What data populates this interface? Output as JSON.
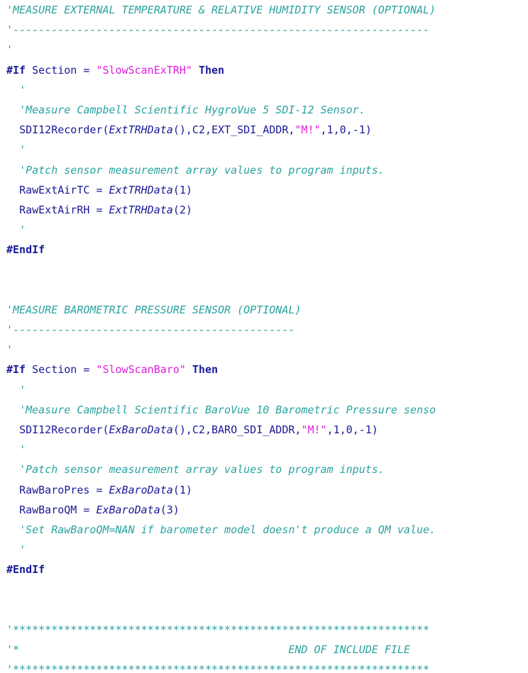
{
  "window": {
    "title": ""
  },
  "code": {
    "lines": [
      {
        "indent": 0,
        "tokens": [
          {
            "t": "cm",
            "v": "'MEASURE EXTERNAL TEMPERATURE & RELATIVE HUMIDITY SENSOR (OPTIONAL)"
          }
        ]
      },
      {
        "indent": 0,
        "tokens": [
          {
            "t": "cm",
            "v": "'-----------------------------------------------------------------"
          }
        ]
      },
      {
        "indent": 0,
        "tokens": [
          {
            "t": "cm",
            "v": "'"
          }
        ]
      },
      {
        "indent": 0,
        "tokens": [
          {
            "t": "kw",
            "v": "#If"
          },
          {
            "t": "plain",
            "v": " Section "
          },
          {
            "t": "op",
            "v": "="
          },
          {
            "t": "plain",
            "v": " "
          },
          {
            "t": "str",
            "v": "\"SlowScanExTRH\""
          },
          {
            "t": "plain",
            "v": " "
          },
          {
            "t": "kw",
            "v": "Then"
          }
        ]
      },
      {
        "indent": 2,
        "tokens": [
          {
            "t": "cm",
            "v": "'"
          }
        ]
      },
      {
        "indent": 2,
        "tokens": [
          {
            "t": "cm",
            "v": "'Measure Campbell Scientific HygroVue 5 SDI-12 Sensor."
          }
        ]
      },
      {
        "indent": 2,
        "tokens": [
          {
            "t": "fn",
            "v": "SDI12Recorder("
          },
          {
            "t": "var",
            "v": "ExtTRHData"
          },
          {
            "t": "plain",
            "v": "(),C2,EXT_SDI_ADDR,"
          },
          {
            "t": "str",
            "v": "\"M!\""
          },
          {
            "t": "plain",
            "v": ",1,0,-1)"
          }
        ]
      },
      {
        "indent": 2,
        "tokens": [
          {
            "t": "cm",
            "v": "'"
          }
        ]
      },
      {
        "indent": 2,
        "tokens": [
          {
            "t": "cm",
            "v": "'Patch sensor measurement array values to program inputs."
          }
        ]
      },
      {
        "indent": 2,
        "tokens": [
          {
            "t": "plain",
            "v": "RawExtAirTC "
          },
          {
            "t": "op",
            "v": "="
          },
          {
            "t": "plain",
            "v": " "
          },
          {
            "t": "var",
            "v": "ExtTRHData"
          },
          {
            "t": "plain",
            "v": "(1)"
          }
        ]
      },
      {
        "indent": 2,
        "tokens": [
          {
            "t": "plain",
            "v": "RawExtAirRH "
          },
          {
            "t": "op",
            "v": "="
          },
          {
            "t": "plain",
            "v": " "
          },
          {
            "t": "var",
            "v": "ExtTRHData"
          },
          {
            "t": "plain",
            "v": "(2)"
          }
        ]
      },
      {
        "indent": 2,
        "tokens": [
          {
            "t": "cm",
            "v": "'"
          }
        ]
      },
      {
        "indent": 0,
        "tokens": [
          {
            "t": "kw",
            "v": "#EndIf"
          }
        ]
      },
      {
        "indent": 0,
        "tokens": []
      },
      {
        "indent": 0,
        "tokens": []
      },
      {
        "indent": 0,
        "tokens": [
          {
            "t": "cm",
            "v": "'MEASURE BAROMETRIC PRESSURE SENSOR (OPTIONAL)"
          }
        ]
      },
      {
        "indent": 0,
        "tokens": [
          {
            "t": "cm",
            "v": "'--------------------------------------------"
          }
        ]
      },
      {
        "indent": 0,
        "tokens": [
          {
            "t": "cm",
            "v": "'"
          }
        ]
      },
      {
        "indent": 0,
        "tokens": [
          {
            "t": "kw",
            "v": "#If"
          },
          {
            "t": "plain",
            "v": " Section "
          },
          {
            "t": "op",
            "v": "="
          },
          {
            "t": "plain",
            "v": " "
          },
          {
            "t": "str",
            "v": "\"SlowScanBaro\""
          },
          {
            "t": "plain",
            "v": " "
          },
          {
            "t": "kw",
            "v": "Then"
          }
        ]
      },
      {
        "indent": 2,
        "tokens": [
          {
            "t": "cm",
            "v": "'"
          }
        ]
      },
      {
        "indent": 2,
        "tokens": [
          {
            "t": "cm",
            "v": "'Measure Campbell Scientific BaroVue 10 Barometric Pressure senso"
          }
        ]
      },
      {
        "indent": 2,
        "tokens": [
          {
            "t": "fn",
            "v": "SDI12Recorder("
          },
          {
            "t": "var",
            "v": "ExBaroData"
          },
          {
            "t": "plain",
            "v": "(),C2,BARO_SDI_ADDR,"
          },
          {
            "t": "str",
            "v": "\"M!\""
          },
          {
            "t": "plain",
            "v": ",1,0,-1)"
          }
        ]
      },
      {
        "indent": 2,
        "tokens": [
          {
            "t": "cm",
            "v": "'"
          }
        ]
      },
      {
        "indent": 2,
        "tokens": [
          {
            "t": "cm",
            "v": "'Patch sensor measurement array values to program inputs."
          }
        ]
      },
      {
        "indent": 2,
        "tokens": [
          {
            "t": "plain",
            "v": "RawBaroPres "
          },
          {
            "t": "op",
            "v": "="
          },
          {
            "t": "plain",
            "v": " "
          },
          {
            "t": "var",
            "v": "ExBaroData"
          },
          {
            "t": "plain",
            "v": "(1)"
          }
        ]
      },
      {
        "indent": 2,
        "tokens": [
          {
            "t": "plain",
            "v": "RawBaroQM "
          },
          {
            "t": "op",
            "v": "="
          },
          {
            "t": "plain",
            "v": " "
          },
          {
            "t": "var",
            "v": "ExBaroData"
          },
          {
            "t": "plain",
            "v": "(3)"
          }
        ]
      },
      {
        "indent": 2,
        "tokens": [
          {
            "t": "cm",
            "v": "'Set RawBaroQM=NAN if barometer model doesn't produce a QM value."
          }
        ]
      },
      {
        "indent": 2,
        "tokens": [
          {
            "t": "cm",
            "v": "'"
          }
        ]
      },
      {
        "indent": 0,
        "tokens": [
          {
            "t": "kw",
            "v": "#EndIf"
          }
        ]
      },
      {
        "indent": 0,
        "tokens": []
      },
      {
        "indent": 0,
        "tokens": []
      },
      {
        "indent": 0,
        "tokens": [
          {
            "t": "cm",
            "v": "'*****************************************************************"
          }
        ]
      },
      {
        "indent": 0,
        "tokens": [
          {
            "t": "cm",
            "v": "'*                                          END OF INCLUDE FILE"
          }
        ]
      },
      {
        "indent": 0,
        "tokens": [
          {
            "t": "cm",
            "v": "'*****************************************************************"
          }
        ]
      }
    ]
  }
}
